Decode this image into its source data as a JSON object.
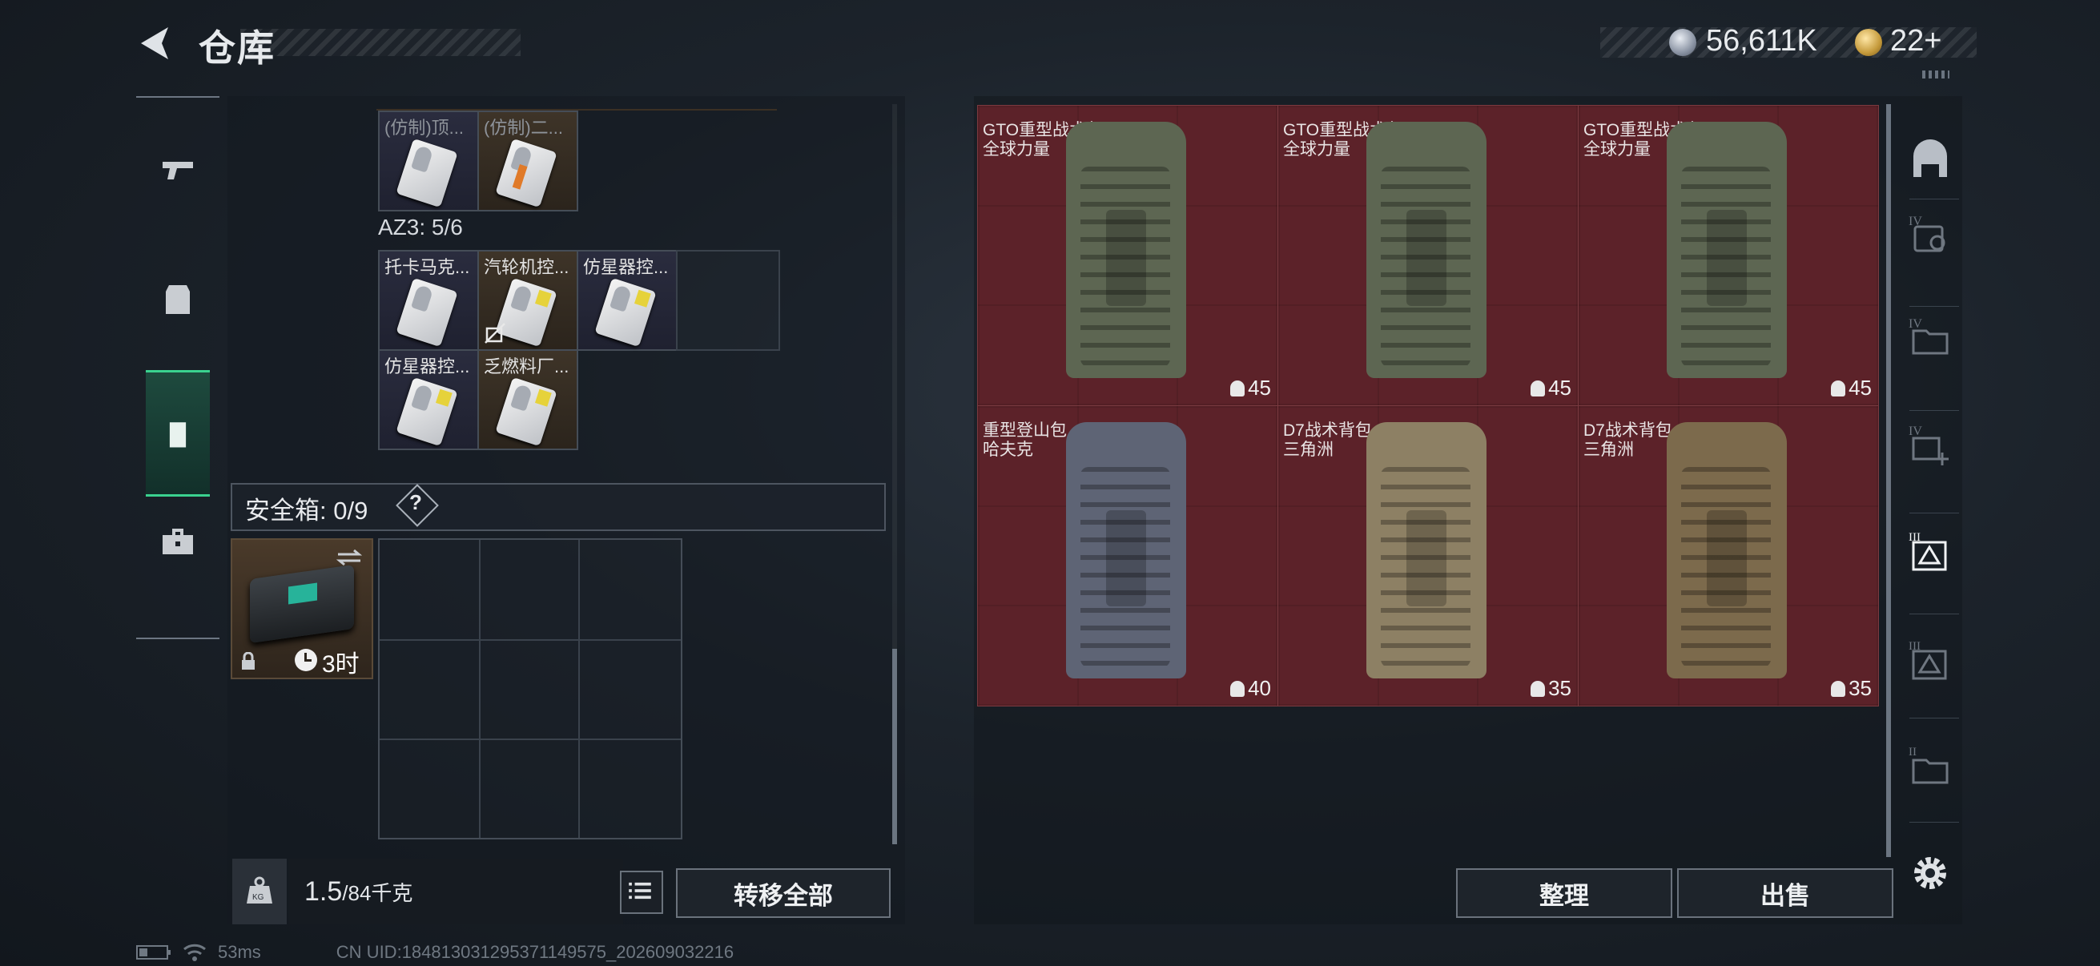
{
  "header": {
    "title": "仓库",
    "currency": "56,611K",
    "tickets": "22+"
  },
  "left_nav": [
    "weapons",
    "armor",
    "backpack",
    "toolbox"
  ],
  "storage": {
    "top_items": [
      {
        "label": "(仿制)顶...",
        "style": "blue"
      },
      {
        "label": "(仿制)二...",
        "style": "brown"
      }
    ],
    "az3_label": "AZ3: 5/6",
    "az3_items": [
      {
        "label": "托卡马克...",
        "style": "blue"
      },
      {
        "label": "汽轮机控...",
        "style": "brown"
      },
      {
        "label": "仿星器控...",
        "style": "blue"
      },
      {
        "label": "仿星器控...",
        "style": "blue"
      },
      {
        "label": "乏燃料厂...",
        "style": "brown"
      }
    ],
    "safebox_label": "安全箱: 0/9",
    "help_mark": "?",
    "safebox_timer": "3时"
  },
  "bottom_left": {
    "weight_current": "1.5",
    "weight_total": "/84千克",
    "transfer_all": "转移全部"
  },
  "backpacks": [
    {
      "name": "GTO重型战术包",
      "source": "全球力量",
      "capacity": "45",
      "color": "#5d6652"
    },
    {
      "name": "GTO重型战术包",
      "source": "全球力量",
      "capacity": "45",
      "color": "#5d6652"
    },
    {
      "name": "GTO重型战术包",
      "source": "全球力量",
      "capacity": "45",
      "color": "#5d6652"
    },
    {
      "name": "重型登山包",
      "source": "哈夫克",
      "capacity": "40",
      "color": "#5e6475"
    },
    {
      "name": "D7战术背包",
      "source": "三角洲",
      "capacity": "35",
      "color": "#8d8064"
    },
    {
      "name": "D7战术背包",
      "source": "三角洲",
      "capacity": "35",
      "color": "#7c6a4c"
    }
  ],
  "right_actions": {
    "sort": "整理",
    "sell": "出售"
  },
  "right_nav": [
    "armor-icon",
    "tier4-cards-icon",
    "tier4-folder-icon",
    "tier4-add-icon",
    "tier3-active-icon",
    "tier3-icon",
    "tier2-icon",
    "settings-icon"
  ],
  "footer": {
    "ping": "53ms",
    "uid": "CN UID:184813031295371149575_202609032216"
  },
  "colors": {
    "accent": "#3ad28f",
    "item_bg": "#5c2229"
  }
}
